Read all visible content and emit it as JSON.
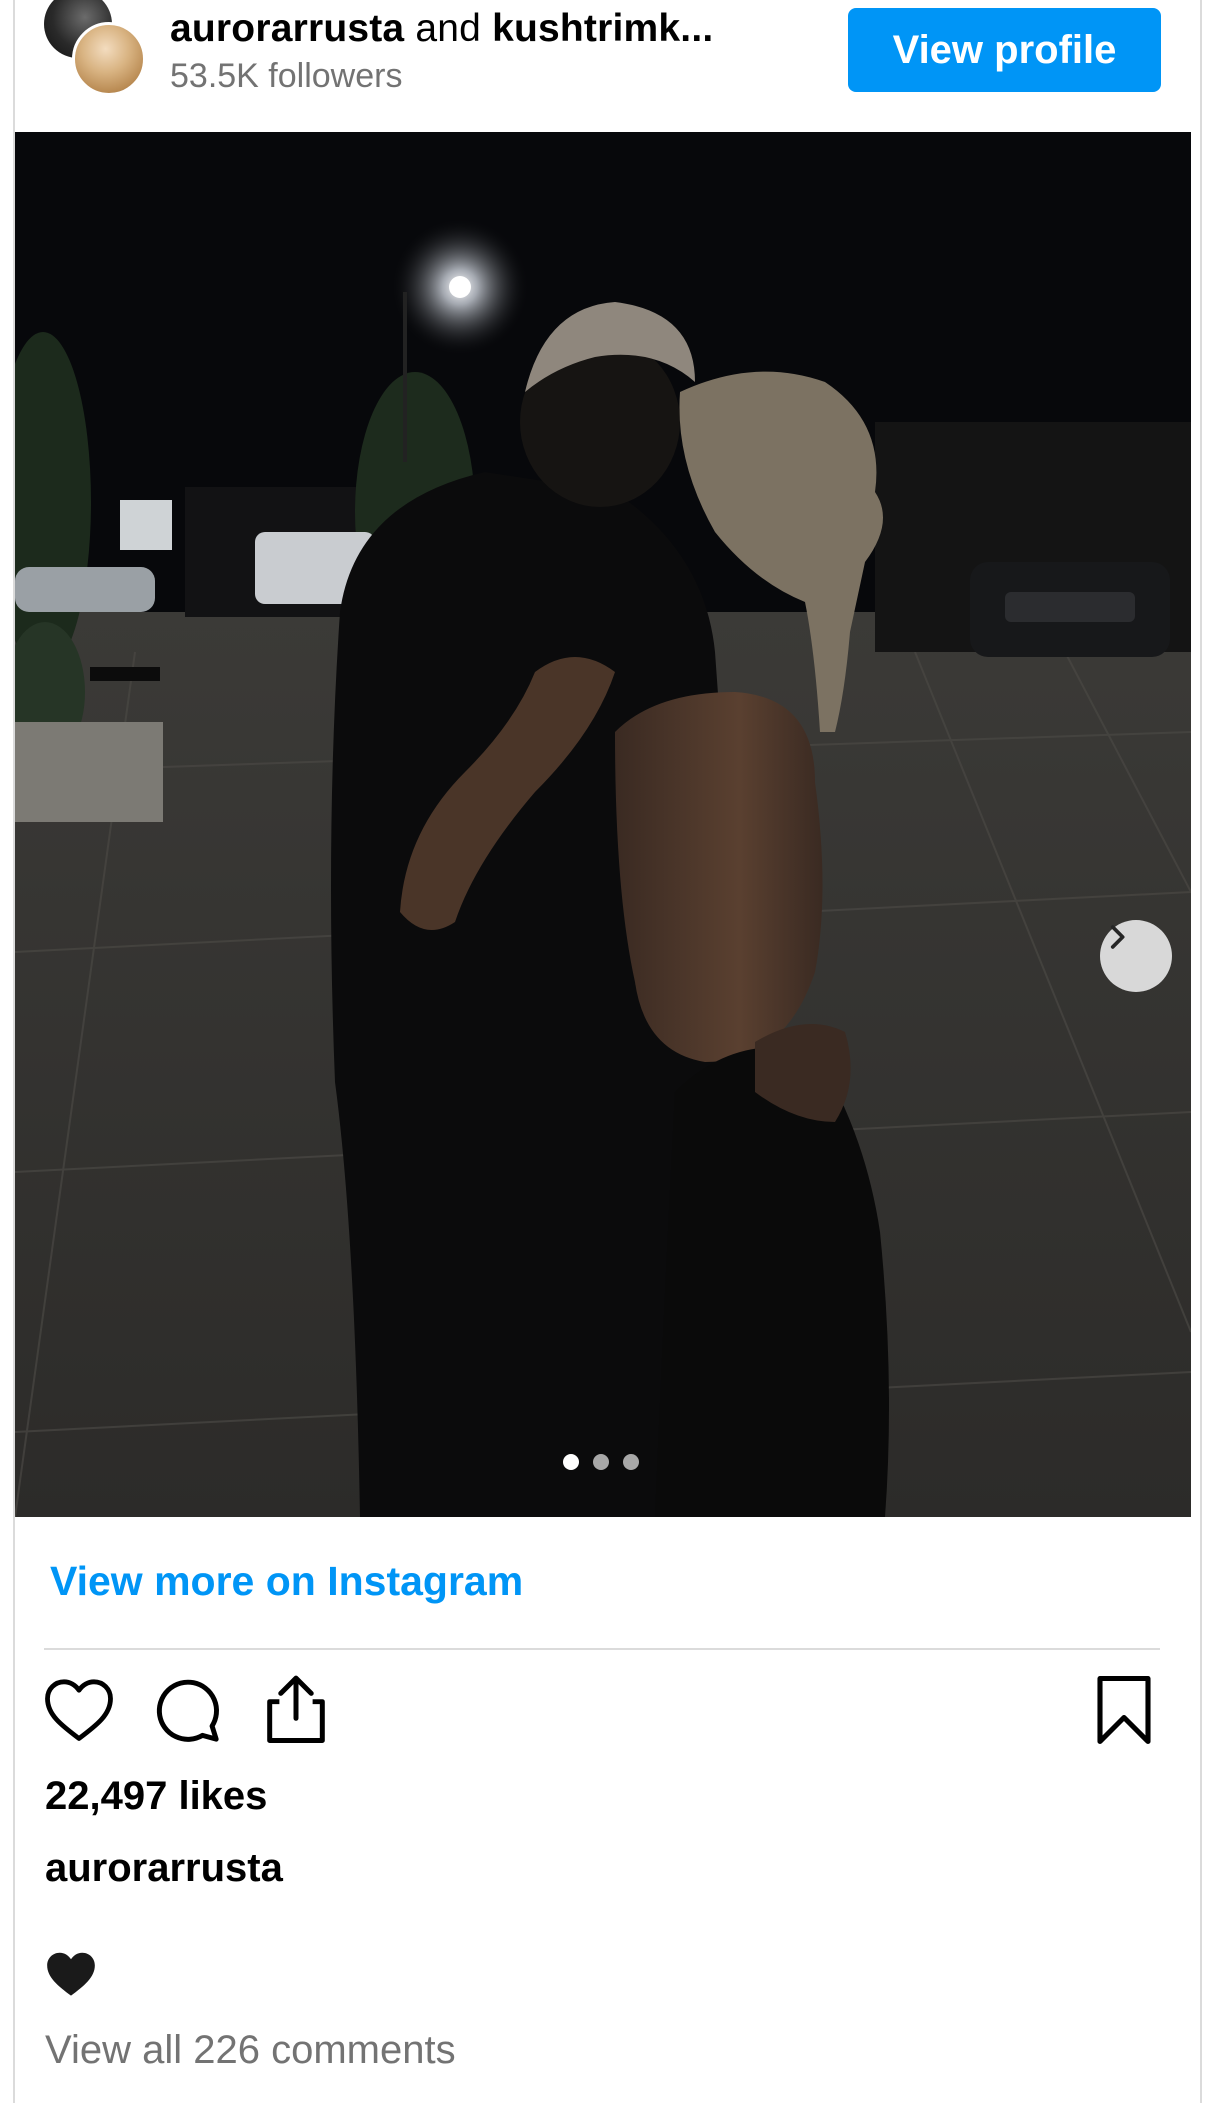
{
  "header": {
    "user1": "aurorarrusta",
    "joiner": "and",
    "user2": "kushtrimk...",
    "followers": "53.5K followers",
    "view_profile_label": "View profile"
  },
  "post": {
    "carousel_total": 3,
    "carousel_active": 1
  },
  "footer": {
    "view_more": "View more on Instagram",
    "likes": "22,497 likes",
    "caption_user": "aurorarrusta",
    "caption_emoji": "black-heart",
    "view_comments": "View all 226 comments"
  },
  "colors": {
    "accent": "#0095f6",
    "muted_text": "#737373",
    "border": "#dbdbdb"
  },
  "icons": [
    "heart-icon",
    "comment-icon",
    "share-icon",
    "bookmark-icon",
    "chevron-right-icon",
    "black-heart-icon"
  ]
}
